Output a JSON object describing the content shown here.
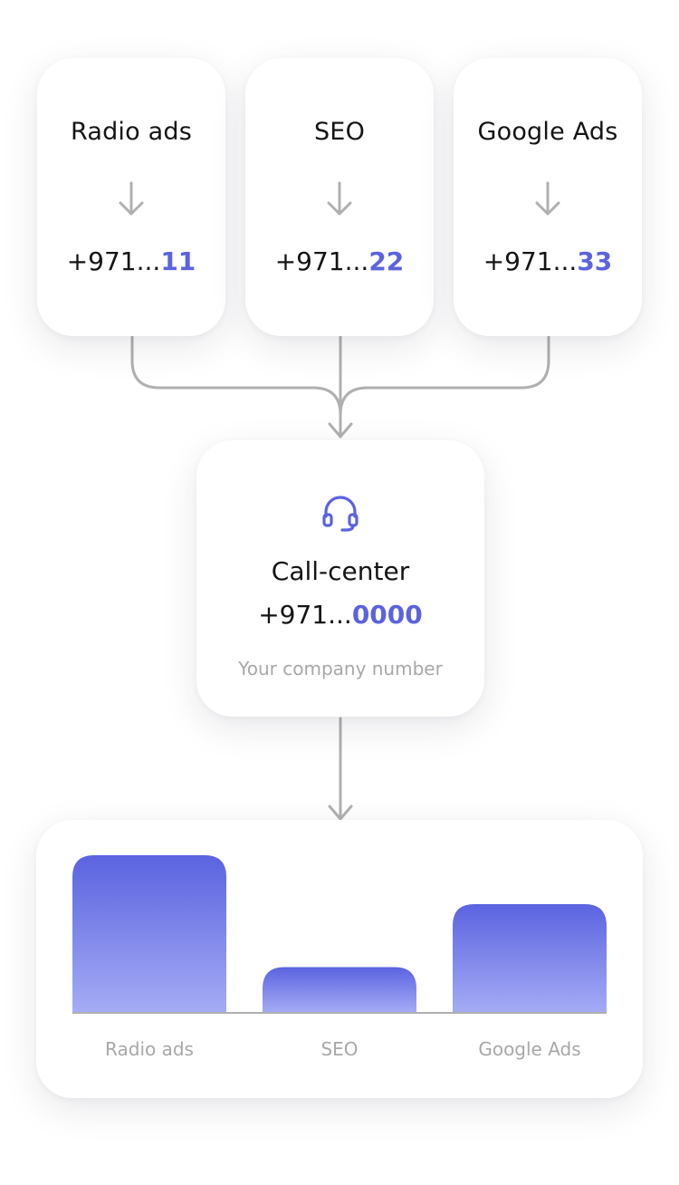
{
  "sources": [
    {
      "name": "Radio ads",
      "phone_prefix": "+971...",
      "phone_suffix": "11"
    },
    {
      "name": "SEO",
      "phone_prefix": "+971...",
      "phone_suffix": "22"
    },
    {
      "name": "Google Ads",
      "phone_prefix": "+971...",
      "phone_suffix": "33"
    }
  ],
  "call_center": {
    "icon": "headset-icon",
    "title": "Call-center",
    "phone_prefix": "+971...",
    "phone_suffix": "0000",
    "subtitle": "Your company number"
  },
  "colors": {
    "accent": "#5b63e0",
    "bar_top": "#5b63e0",
    "bar_bottom": "#a5acf5",
    "connector": "#b0b0b0",
    "muted_text": "#a8a8a8"
  },
  "chart_data": {
    "type": "bar",
    "categories": [
      "Radio ads",
      "SEO",
      "Google Ads"
    ],
    "values": [
      100,
      29,
      69
    ],
    "ylim": [
      0,
      100
    ],
    "grid": false,
    "legend": "none"
  }
}
